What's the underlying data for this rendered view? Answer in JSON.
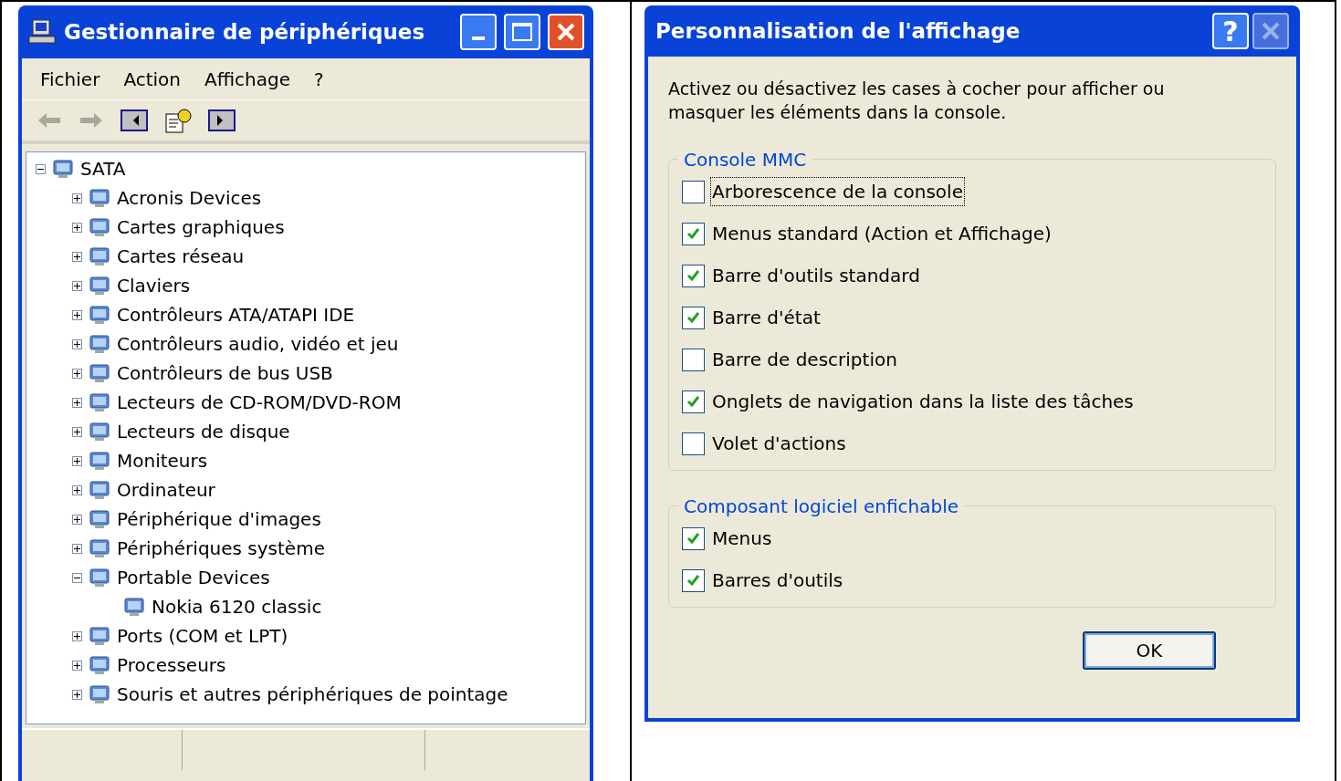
{
  "device_manager": {
    "title": "Gestionnaire de périphériques",
    "menu": [
      "Fichier",
      "Action",
      "Affichage",
      "?"
    ],
    "tree": {
      "label": "SATA",
      "expanded": true,
      "children": [
        {
          "label": "Acronis Devices",
          "expanded": false
        },
        {
          "label": "Cartes graphiques",
          "expanded": false
        },
        {
          "label": "Cartes réseau",
          "expanded": false
        },
        {
          "label": "Claviers",
          "expanded": false
        },
        {
          "label": "Contrôleurs ATA/ATAPI IDE",
          "expanded": false
        },
        {
          "label": "Contrôleurs audio, vidéo et jeu",
          "expanded": false
        },
        {
          "label": "Contrôleurs de bus USB",
          "expanded": false
        },
        {
          "label": "Lecteurs de CD-ROM/DVD-ROM",
          "expanded": false
        },
        {
          "label": "Lecteurs de disque",
          "expanded": false
        },
        {
          "label": "Moniteurs",
          "expanded": false
        },
        {
          "label": "Ordinateur",
          "expanded": false
        },
        {
          "label": "Périphérique d'images",
          "expanded": false
        },
        {
          "label": "Périphériques système",
          "expanded": false
        },
        {
          "label": "Portable Devices",
          "expanded": true,
          "children": [
            {
              "label": "Nokia 6120 classic"
            }
          ]
        },
        {
          "label": "Ports (COM et LPT)",
          "expanded": false
        },
        {
          "label": "Processeurs",
          "expanded": false
        },
        {
          "label": "Souris et autres périphériques de pointage",
          "expanded": false
        }
      ]
    }
  },
  "dialog": {
    "title": "Personnalisation de l'affichage",
    "help_button": "?",
    "intro": "Activez ou désactivez les cases à cocher pour afficher ou masquer les éléments dans la console.",
    "groups": [
      {
        "title": "Console MMC",
        "options": [
          {
            "label": "Arborescence de la console",
            "checked": false,
            "focused": true
          },
          {
            "label": "Menus standard (Action et Affichage)",
            "checked": true,
            "focused": false
          },
          {
            "label": "Barre d'outils standard",
            "checked": true,
            "focused": false
          },
          {
            "label": "Barre d'état",
            "checked": true,
            "focused": false
          },
          {
            "label": "Barre de description",
            "checked": false,
            "focused": false
          },
          {
            "label": "Onglets de navigation dans la liste des tâches",
            "checked": true,
            "focused": false
          },
          {
            "label": "Volet d'actions",
            "checked": false,
            "focused": false
          }
        ]
      },
      {
        "title": "Composant logiciel enfichable",
        "options": [
          {
            "label": "Menus",
            "checked": true,
            "focused": false
          },
          {
            "label": "Barres d'outils",
            "checked": true,
            "focused": false
          }
        ]
      }
    ],
    "ok_button": "OK"
  }
}
